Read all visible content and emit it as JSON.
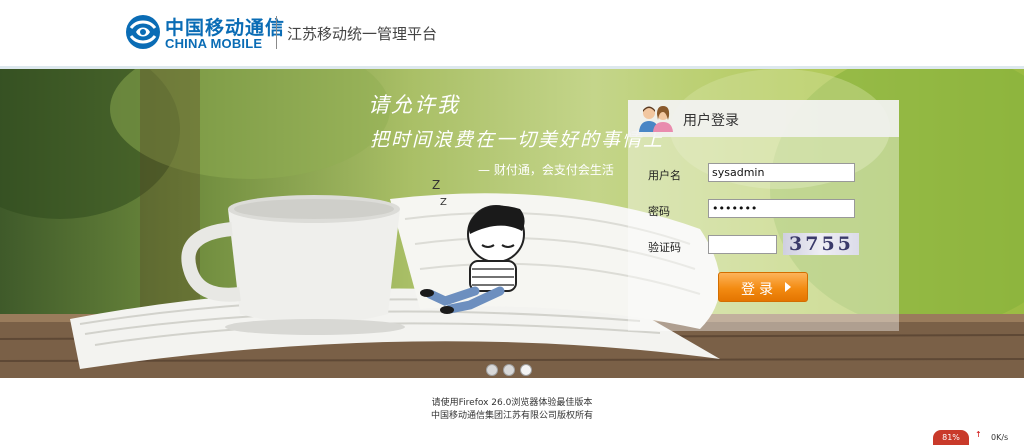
{
  "header": {
    "logo_cn": "中国移动通信",
    "logo_en": "CHINA MOBILE",
    "platform_title": "江苏移动统一管理平台",
    "brand_color": "#0a6cb5"
  },
  "banner": {
    "slogan_line1": "请允许我",
    "slogan_line2": "把时间浪费在一切美好的事情上",
    "slogan_line3": "— 财付通，会支付会生活",
    "illustration": "coffee-cup-book-boy-illustration",
    "slides": 3
  },
  "login": {
    "title": "用户登录",
    "username_label": "用户名",
    "username_value": "sysadmin",
    "password_label": "密码",
    "password_value": "•••••••",
    "captcha_label": "验证码",
    "captcha_value": "",
    "captcha_text": "3755",
    "submit_label": "登录",
    "accent_color": "#f38b12"
  },
  "footer": {
    "browser_hint": "请使用Firefox 26.0浏览器体验最佳版本",
    "copyright": "中国移动通信集团江苏有限公司版权所有"
  },
  "corner_widget": {
    "badge": "81%",
    "speed_up_icon": "↑",
    "speed": "0K/s"
  }
}
